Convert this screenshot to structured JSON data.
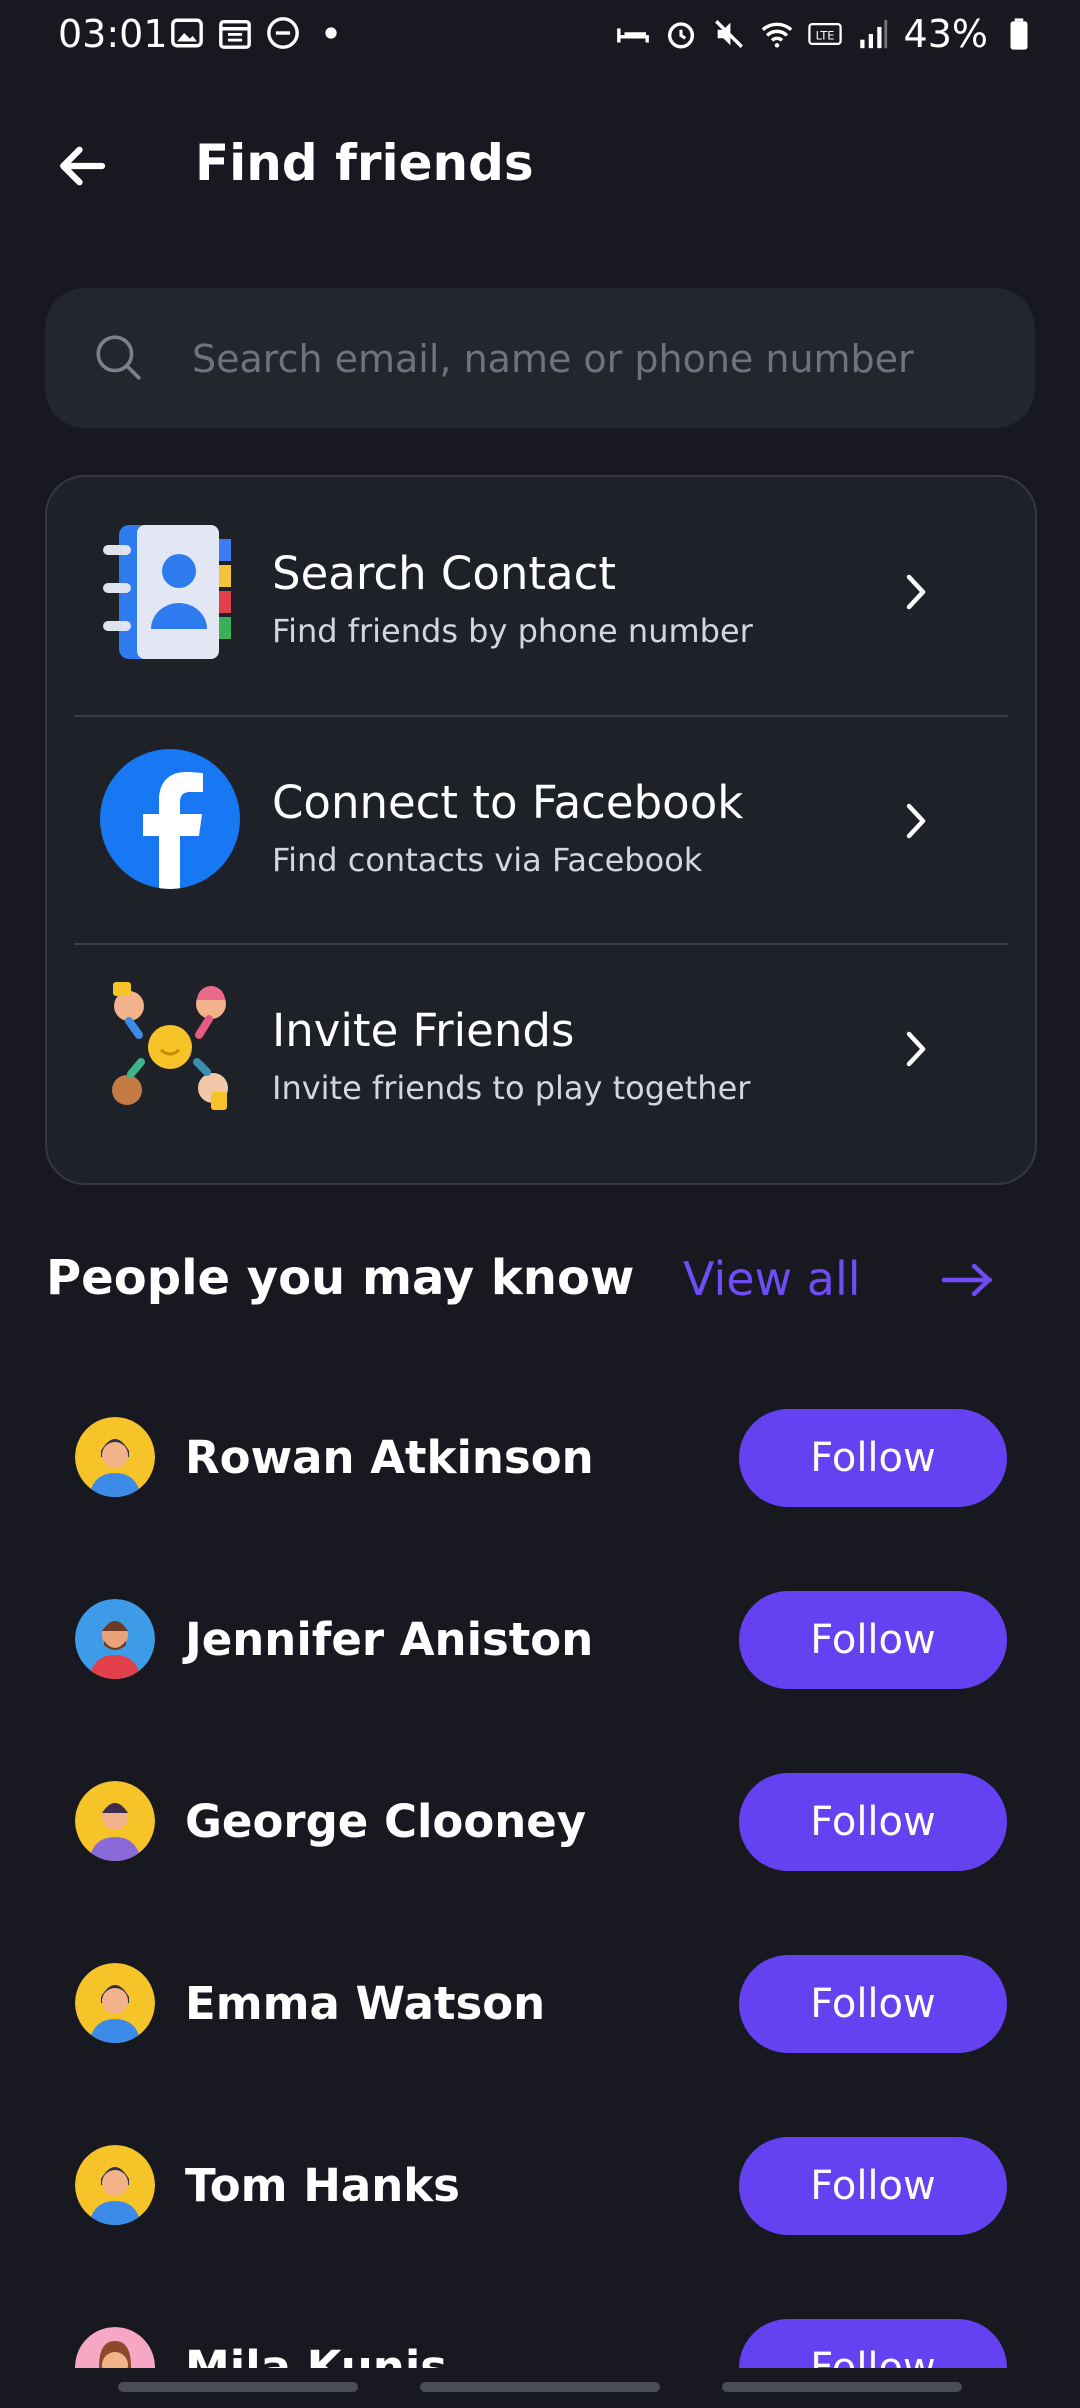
{
  "status_bar": {
    "time": "03:01",
    "battery": "43%"
  },
  "header": {
    "title": "Find friends"
  },
  "search": {
    "placeholder": "Search email, name or phone number"
  },
  "options": [
    {
      "title": "Search Contact",
      "subtitle": "Find friends by phone number",
      "icon": "contacts-book-icon"
    },
    {
      "title": "Connect to Facebook",
      "subtitle": "Find contacts via Facebook",
      "icon": "facebook-icon"
    },
    {
      "title": "Invite Friends",
      "subtitle": "Invite friends to play together",
      "icon": "invite-friends-icon"
    }
  ],
  "people_section": {
    "title": "People you may know",
    "view_all": "View all"
  },
  "people": [
    {
      "name": "Rowan Atkinson",
      "action": "Follow"
    },
    {
      "name": "Jennifer Aniston",
      "action": "Follow"
    },
    {
      "name": "George Clooney",
      "action": "Follow"
    },
    {
      "name": "Emma Watson",
      "action": "Follow"
    },
    {
      "name": "Tom Hanks",
      "action": "Follow"
    },
    {
      "name": "Mila Kunis",
      "action": "Follow"
    }
  ],
  "colors": {
    "background": "#181920",
    "accent": "#6442f2",
    "link": "#6f4cf6",
    "facebook": "#1877f2"
  }
}
